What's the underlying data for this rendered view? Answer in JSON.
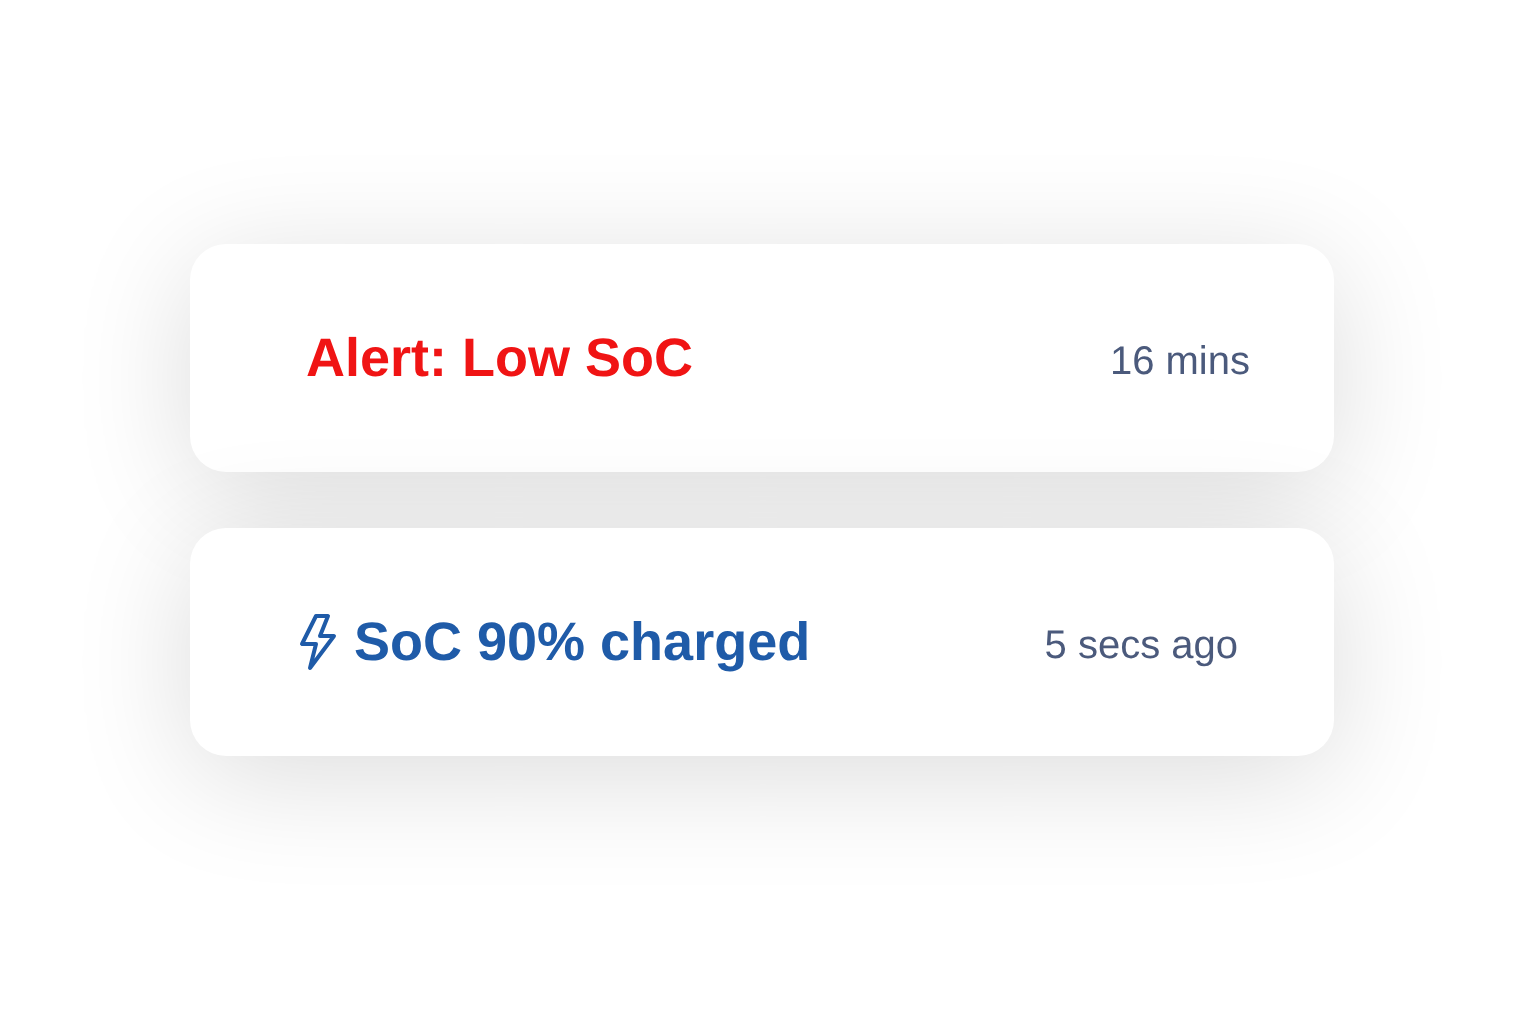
{
  "notifications": [
    {
      "kind": "alert",
      "title": "Alert: Low SoC",
      "time": "16 mins"
    },
    {
      "kind": "charging",
      "title": "SoC 90% charged",
      "time": "5 secs ago"
    }
  ]
}
